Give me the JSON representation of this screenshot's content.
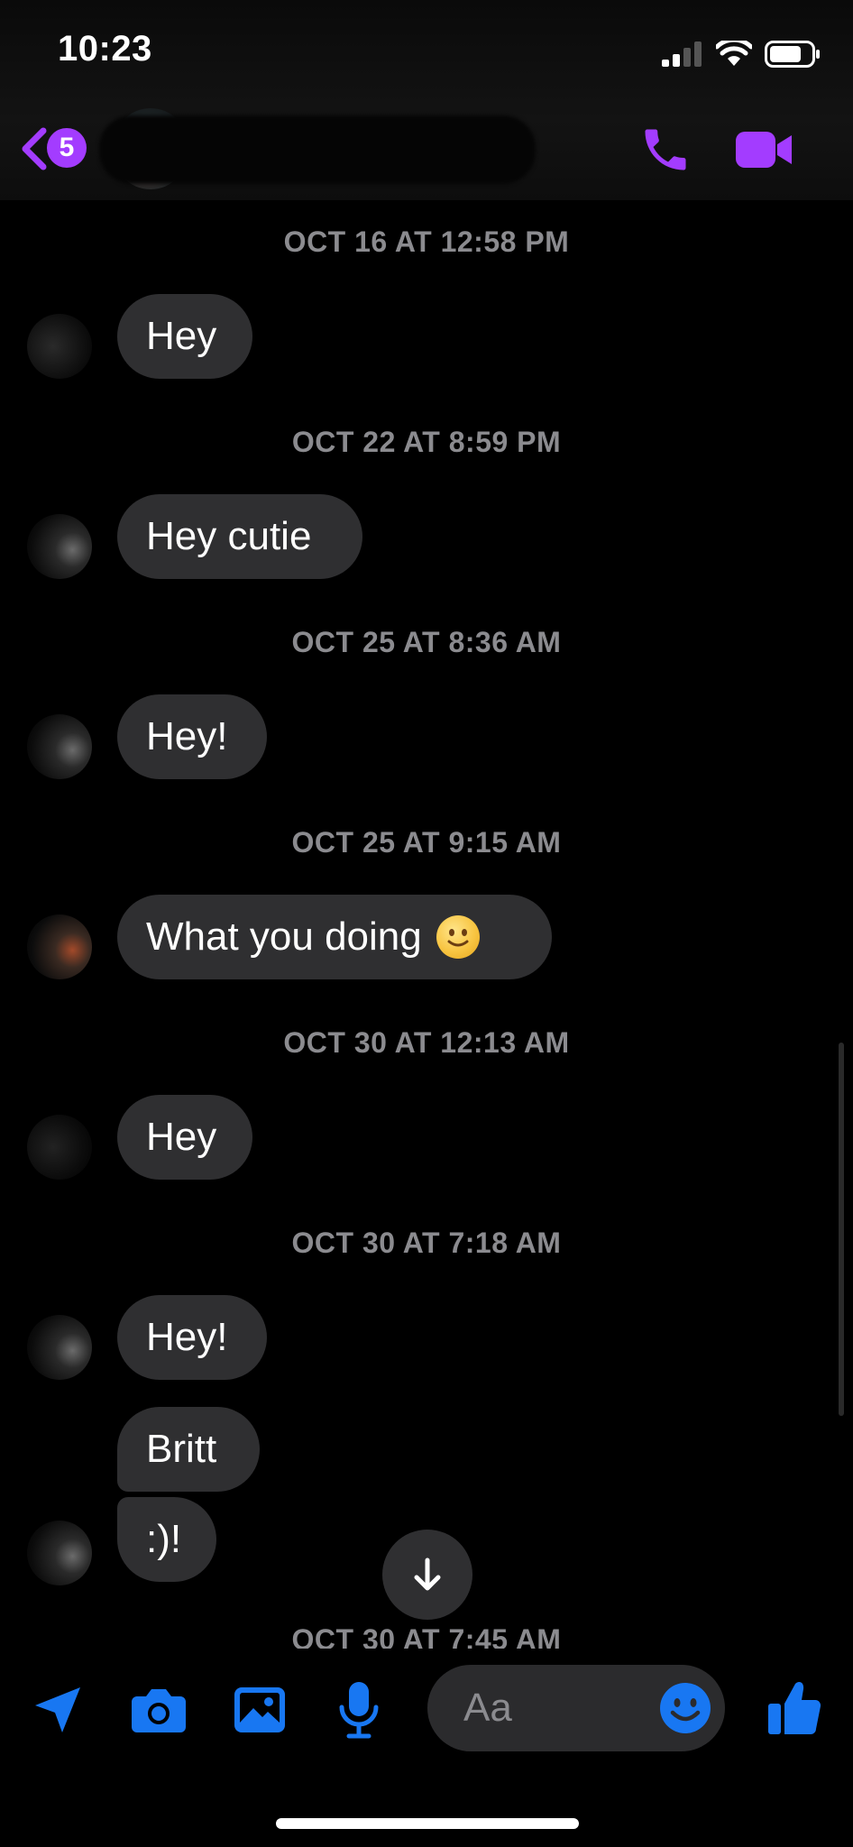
{
  "status_bar": {
    "time": "10:23",
    "icons": [
      "cellular-signal-icon",
      "wifi-icon",
      "battery-icon"
    ]
  },
  "header": {
    "back_icon": "chevron-left-icon",
    "unread_count": "5",
    "actions": [
      "phone-icon",
      "video-camera-icon"
    ],
    "accent_color": "#A33CFF"
  },
  "conversation": [
    {
      "timestamp": "OCT 16 AT 12:58 PM",
      "messages": [
        {
          "text": "Hey"
        }
      ]
    },
    {
      "timestamp": "OCT 22 AT 8:59 PM",
      "messages": [
        {
          "text": "Hey cutie"
        }
      ]
    },
    {
      "timestamp": "OCT 25 AT 8:36 AM",
      "messages": [
        {
          "text": "Hey!"
        }
      ]
    },
    {
      "timestamp": "OCT 25 AT 9:15 AM",
      "messages": [
        {
          "text": "What you doing",
          "emoji": "slightly-smiling-face"
        }
      ]
    },
    {
      "timestamp": "OCT 30 AT 12:13 AM",
      "messages": [
        {
          "text": "Hey"
        }
      ]
    },
    {
      "timestamp": "OCT 30 AT 7:18 AM",
      "messages": [
        {
          "text": "Hey!"
        },
        {
          "text": "Britt"
        },
        {
          "text": ":)!"
        }
      ]
    },
    {
      "timestamp": "OCT 30 AT 7:45 AM",
      "messages": []
    }
  ],
  "scroll_down_icon": "arrow-down-icon",
  "composer": {
    "icons": [
      "location-arrow-icon",
      "camera-icon",
      "photo-icon",
      "microphone-icon",
      "emoji-icon",
      "thumbs-up-icon"
    ],
    "placeholder": "Aa",
    "accent_color": "#1877F2"
  }
}
